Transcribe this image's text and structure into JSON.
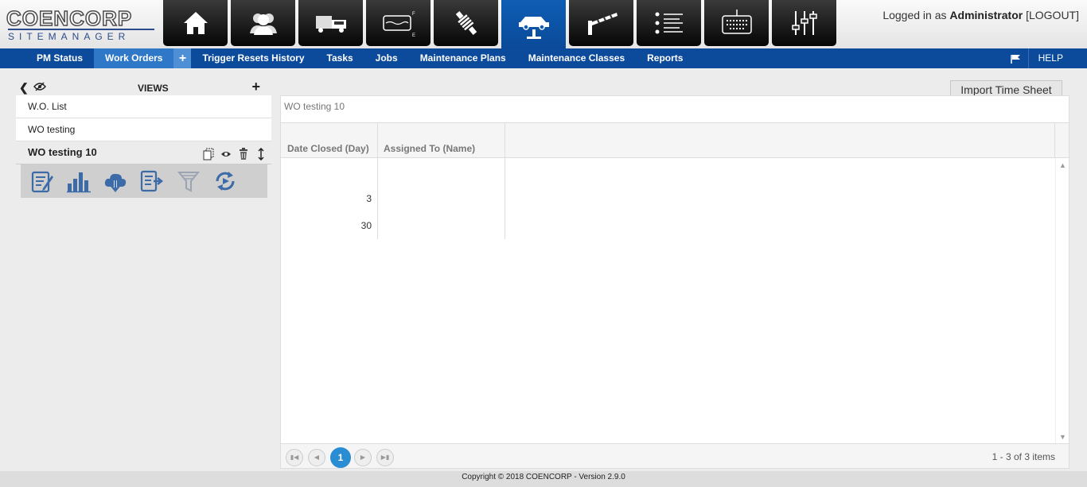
{
  "header": {
    "logo_main": "COENCORP",
    "logo_sub": "SITEMANAGER",
    "login_prefix": "Logged in as ",
    "login_user": "Administrator",
    "logout_label": "[LOGOUT]",
    "tiles": [
      {
        "icon": "home-icon"
      },
      {
        "icon": "users-icon"
      },
      {
        "icon": "vehicles-icon"
      },
      {
        "icon": "fuel-gauge-icon"
      },
      {
        "icon": "suspension-icon"
      },
      {
        "icon": "car-lift-icon"
      },
      {
        "icon": "barrier-gate-icon"
      },
      {
        "icon": "list-icon"
      },
      {
        "icon": "keypad-icon"
      },
      {
        "icon": "sliders-icon"
      }
    ]
  },
  "nav": {
    "items": [
      "PM Status",
      "Work Orders",
      "Trigger Resets History",
      "Tasks",
      "Jobs",
      "Maintenance Plans",
      "Maintenance Classes",
      "Reports"
    ],
    "plus_label": "+",
    "help_label": "HELP"
  },
  "sidebar": {
    "views_title": "VIEWS",
    "items": [
      "W.O. List",
      "WO testing",
      "WO testing 10"
    ],
    "selected": "WO testing 10"
  },
  "main": {
    "import_label": "Import Time Sheet",
    "grid_title": "WO testing 10",
    "columns": [
      "Date Closed (Day)",
      "Assigned To (Name)"
    ],
    "rows": [
      [
        "",
        ""
      ],
      [
        "3",
        ""
      ],
      [
        "30",
        ""
      ]
    ],
    "pager": {
      "current_page": "1",
      "info": "1 - 3 of 3 items"
    }
  },
  "footer": {
    "copyright": "Copyright © 2018 COENCORP - Version 2.9.0"
  },
  "colors": {
    "nav_bg": "#0c4a9c",
    "nav_selected": "#2f78c8",
    "tile_active": "#0f5db5",
    "pager_current": "#2a8dd4"
  }
}
